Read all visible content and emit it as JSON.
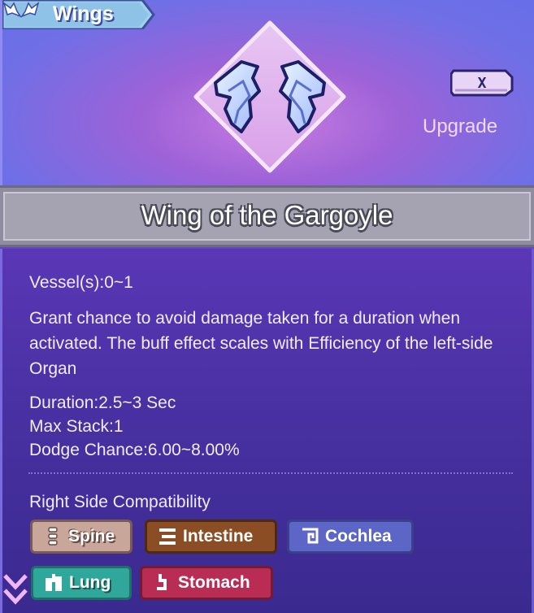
{
  "category": {
    "label": "Wings",
    "icon": "wings-icon"
  },
  "item": {
    "name": "Wing of the Gargoyle",
    "icon": "gargoyle-wings-icon"
  },
  "upgrade": {
    "key": "X",
    "label": "Upgrade"
  },
  "details": {
    "vessels": "Vessel(s):0~1",
    "description": "Grant chance to avoid damage taken for a duration when activated. The buff effect scales with Efficiency of the left-side Organ",
    "stats": [
      "Duration:2.5~3 Sec",
      "Max Stack:1",
      "Dodge Chance:6.00~8.00%"
    ]
  },
  "compatibility": {
    "title": "Right Side Compatibility",
    "tags": [
      {
        "label": "Spine",
        "icon": "spine-icon",
        "color": "#c8a79a"
      },
      {
        "label": "Intestine",
        "icon": "intestine-icon",
        "color": "#8a4d24"
      },
      {
        "label": "Cochlea",
        "icon": "cochlea-icon",
        "color": "#5b66c6"
      },
      {
        "label": "Lung",
        "icon": "lung-icon",
        "color": "#2fa89b"
      },
      {
        "label": "Stomach",
        "icon": "stomach-icon",
        "color": "#b92d54"
      }
    ]
  },
  "colors": {
    "panel_top": "#6a72e6",
    "panel_bottom": "#3b2b95",
    "title_bar": "#a5a3b1"
  }
}
